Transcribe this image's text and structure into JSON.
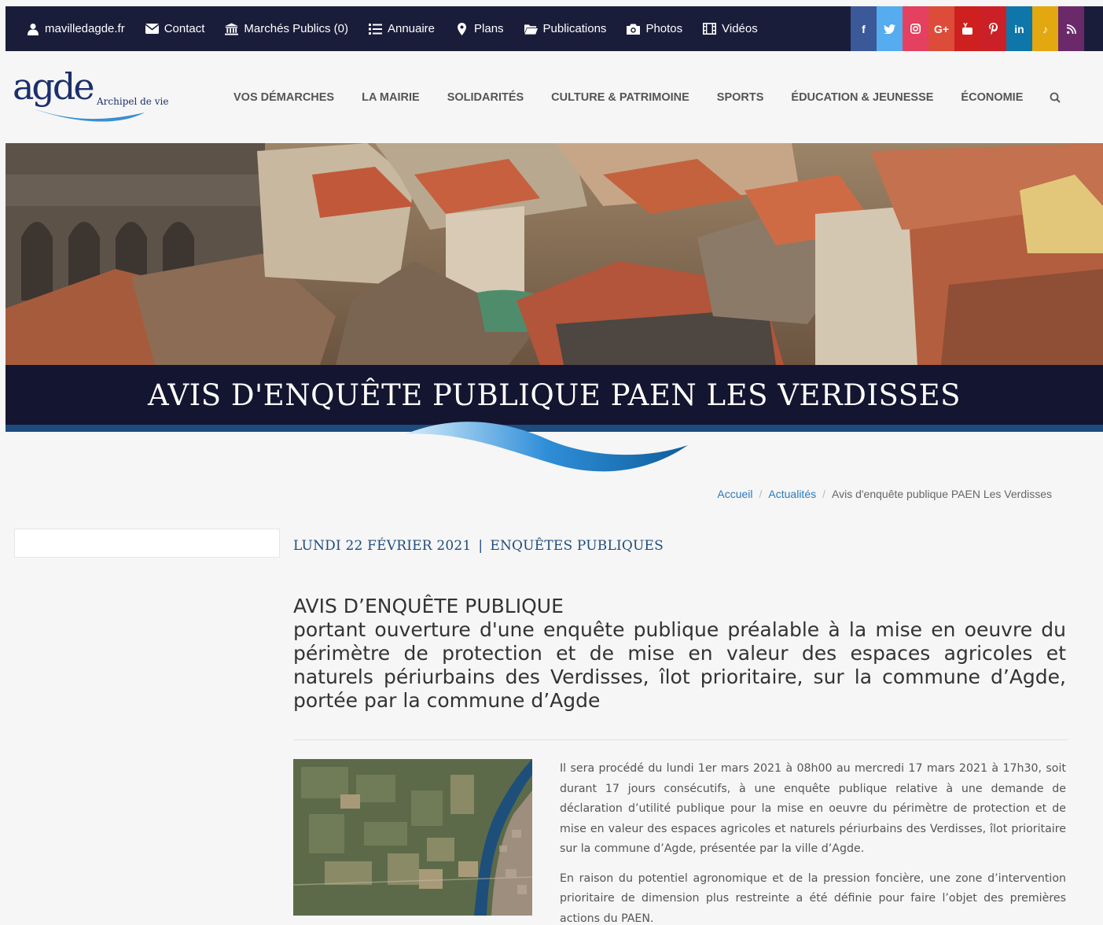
{
  "topbar": {
    "links": [
      {
        "label": "mavilledagde.fr",
        "icon": "user-icon"
      },
      {
        "label": "Contact",
        "icon": "envelope-icon"
      },
      {
        "label": "Marchés Publics (0)",
        "icon": "institution-icon"
      },
      {
        "label": "Annuaire",
        "icon": "list-icon"
      },
      {
        "label": "Plans",
        "icon": "map-pin-icon"
      },
      {
        "label": "Publications",
        "icon": "folder-icon"
      },
      {
        "label": "Photos",
        "icon": "camera-icon"
      },
      {
        "label": "Vidéos",
        "icon": "film-icon"
      }
    ],
    "social": [
      {
        "icon": "facebook-icon",
        "glyph": "f",
        "color": "#3b5998"
      },
      {
        "icon": "twitter-icon",
        "glyph": "🐦",
        "color": "#55acee"
      },
      {
        "icon": "instagram-icon",
        "glyph": "◎",
        "color": "#e4405f"
      },
      {
        "icon": "google-plus-icon",
        "glyph": "G+",
        "color": "#dd4b39"
      },
      {
        "icon": "youtube-icon",
        "glyph": "▶",
        "color": "#cd201f"
      },
      {
        "icon": "pinterest-icon",
        "glyph": "P",
        "color": "#cb2027"
      },
      {
        "icon": "linkedin-icon",
        "glyph": "in",
        "color": "#0e76a8"
      },
      {
        "icon": "tiktok-icon",
        "glyph": "♪",
        "color": "#e3a70f"
      },
      {
        "icon": "rss-icon",
        "glyph": "⋑",
        "color": "#6a2a6a"
      }
    ]
  },
  "logo": {
    "word": "agde",
    "tagline": "Archipel de vie"
  },
  "nav": {
    "items": [
      "VOS DÉMARCHES",
      "LA MAIRIE",
      "SOLIDARITÉS",
      "CULTURE & PATRIMOINE",
      "SPORTS",
      "ÉDUCATION & JEUNESSE",
      "ÉCONOMIE"
    ]
  },
  "page": {
    "title": "AVIS D'ENQUÊTE PUBLIQUE PAEN LES VERDISSES"
  },
  "breadcrumb": {
    "home": "Accueil",
    "section": "Actualités",
    "current": "Avis d'enquête publique PAEN Les Verdisses",
    "separator": "/"
  },
  "article": {
    "date": "LUNDI 22 FÉVRIER 2021",
    "pipe": "|",
    "category": "ENQUÊTES PUBLIQUES",
    "title_line1": "AVIS D’ENQUÊTE PUBLIQUE",
    "title_line2": "portant ouverture d'une enquête publique préalable à la mise en oeuvre du périmètre de protection et de mise en valeur des espaces agricoles et naturels périurbains des Verdisses, îlot prioritaire, sur la commune d’Agde, portée par la commune d’Agde",
    "paragraphs": [
      "Il sera procédé du lundi 1er mars 2021 à 08h00 au mercredi 17 mars 2021 à 17h30, soit durant 17 jours consécutifs, à une enquête publique relative à une demande de déclaration d’utilité publique pour la mise en oeuvre du périmètre de protection et de mise en valeur des espaces agricoles et naturels périurbains des Verdisses, îlot prioritaire sur la commune d’Agde, présentée par la ville d’Agde.",
      "En raison du potentiel agronomique et de la pression foncière, une zone d’intervention prioritaire de dimension plus restreinte a été définie pour faire l’objet des premières actions du PAEN."
    ]
  }
}
